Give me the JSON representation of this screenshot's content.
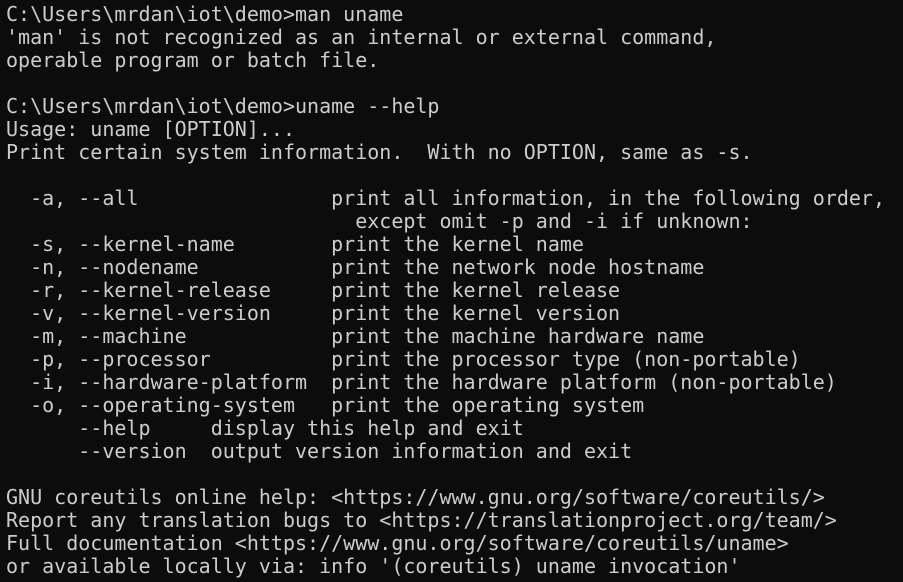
{
  "terminal": {
    "background": "#0c0c0c",
    "foreground": "#cccccc",
    "lines": [
      "C:\\Users\\mrdan\\iot\\demo>man uname",
      "'man' is not recognized as an internal or external command,",
      "operable program or batch file.",
      "",
      "C:\\Users\\mrdan\\iot\\demo>uname --help",
      "Usage: uname [OPTION]...",
      "Print certain system information.  With no OPTION, same as -s.",
      "",
      "  -a, --all                print all information, in the following order,",
      "                             except omit -p and -i if unknown:",
      "  -s, --kernel-name        print the kernel name",
      "  -n, --nodename           print the network node hostname",
      "  -r, --kernel-release     print the kernel release",
      "  -v, --kernel-version     print the kernel version",
      "  -m, --machine            print the machine hardware name",
      "  -p, --processor          print the processor type (non-portable)",
      "  -i, --hardware-platform  print the hardware platform (non-portable)",
      "  -o, --operating-system   print the operating system",
      "      --help     display this help and exit",
      "      --version  output version information and exit",
      "",
      "GNU coreutils online help: <https://www.gnu.org/software/coreutils/>",
      "Report any translation bugs to <https://translationproject.org/team/>",
      "Full documentation <https://www.gnu.org/software/coreutils/uname>",
      "or available locally via: info '(coreutils) uname invocation'"
    ]
  }
}
